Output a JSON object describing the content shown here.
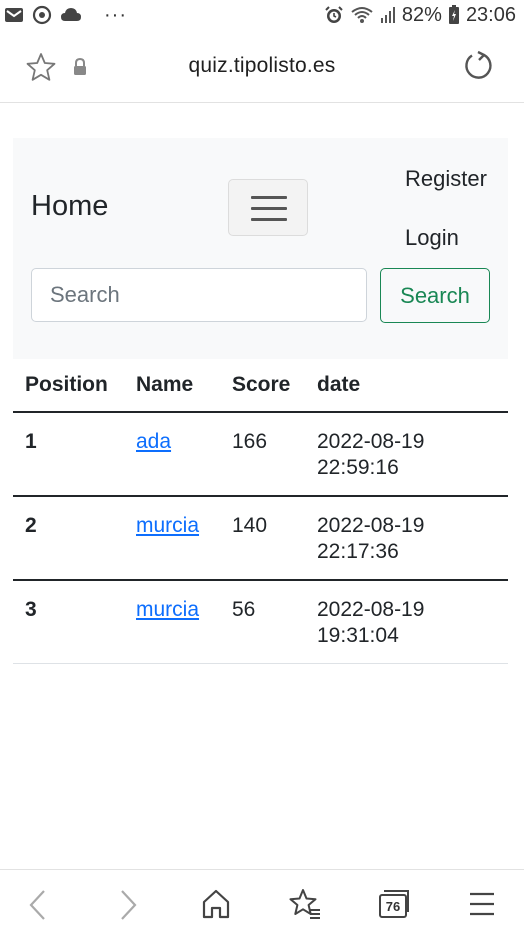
{
  "status_bar": {
    "battery": "82%",
    "time": "23:06",
    "dots": "···"
  },
  "browser": {
    "url": "quiz.tipolisto.es",
    "tabs_count": "76"
  },
  "navbar": {
    "brand": "Home",
    "register": "Register",
    "login": "Login",
    "search_placeholder": "Search",
    "search_button": "Search"
  },
  "table": {
    "headers": [
      "Position",
      "Name",
      "Score",
      "date"
    ],
    "rows": [
      {
        "position": "1",
        "name": "ada",
        "score": "166",
        "date": "2022-08-19",
        "time": "22:59:16"
      },
      {
        "position": "2",
        "name": "murcia",
        "score": "140",
        "date": "2022-08-19",
        "time": "22:17:36"
      },
      {
        "position": "3",
        "name": "murcia",
        "score": "56",
        "date": "2022-08-19",
        "time": "19:31:04"
      }
    ]
  }
}
